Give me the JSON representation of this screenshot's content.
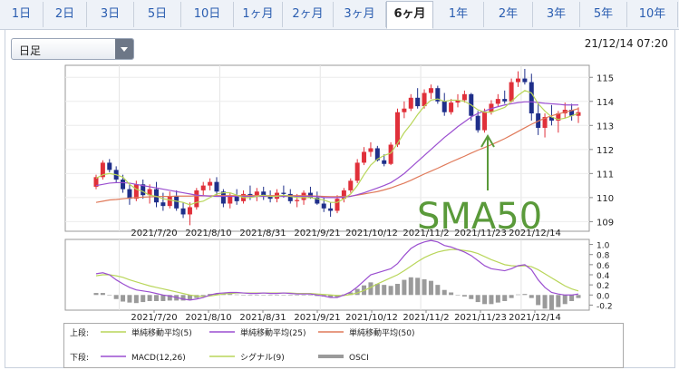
{
  "tabs": [
    {
      "label": "1日",
      "active": false
    },
    {
      "label": "2日",
      "active": false
    },
    {
      "label": "3日",
      "active": false
    },
    {
      "label": "5日",
      "active": false
    },
    {
      "label": "10日",
      "active": false
    },
    {
      "label": "1ヶ月",
      "active": false
    },
    {
      "label": "2ヶ月",
      "active": false
    },
    {
      "label": "3ヶ月",
      "active": false
    },
    {
      "label": "6ヶ月",
      "active": true
    },
    {
      "label": "1年",
      "active": false
    },
    {
      "label": "2年",
      "active": false
    },
    {
      "label": "3年",
      "active": false
    },
    {
      "label": "5年",
      "active": false
    },
    {
      "label": "10年",
      "active": false
    }
  ],
  "selector": {
    "value": "日足"
  },
  "timestamp": "21/12/14 07:20",
  "colors": {
    "up": "#e0303a",
    "down": "#1f2f8a",
    "sma5": "#b9d65a",
    "sma25": "#9b4fd0",
    "sma50": "#e07a5a",
    "macd": "#9b4fd0",
    "signal": "#b9d65a",
    "osci": "#9a9a9a",
    "annotation": "#5a9a3a"
  },
  "annotation": {
    "text": "SMA50"
  },
  "legend": {
    "upper_label": "上段:",
    "lower_label": "下段:",
    "items_upper": [
      {
        "label": "単純移動平均(5)"
      },
      {
        "label": "単純移動平均(25)"
      },
      {
        "label": "単純移動平均(50)"
      }
    ],
    "items_lower": [
      {
        "label": "MACD(12,26)"
      },
      {
        "label": "シグナル(9)"
      },
      {
        "label": "OSCI"
      }
    ]
  },
  "chart_data": [
    {
      "type": "candlestick",
      "x_tick_labels": [
        "2021/7/20",
        "2021/8/10",
        "2021/8/31",
        "2021/9/21",
        "2021/10/12",
        "2021/11/2",
        "2021/11/23",
        "2021/12/14"
      ],
      "yticks": [
        109,
        110,
        111,
        112,
        113,
        114,
        115
      ],
      "ylim": [
        108.6,
        115.5
      ],
      "candles": [
        [
          110.45,
          110.95,
          110.35,
          110.85
        ],
        [
          110.85,
          111.55,
          110.75,
          111.45
        ],
        [
          111.45,
          111.6,
          111.05,
          111.15
        ],
        [
          111.15,
          111.3,
          110.6,
          110.75
        ],
        [
          110.75,
          110.95,
          110.2,
          110.35
        ],
        [
          110.35,
          110.55,
          109.7,
          109.95
        ],
        [
          109.95,
          110.7,
          109.85,
          110.55
        ],
        [
          110.55,
          110.75,
          109.95,
          110.1
        ],
        [
          110.1,
          110.55,
          109.75,
          110.35
        ],
        [
          110.35,
          110.65,
          109.6,
          109.8
        ],
        [
          109.8,
          110.2,
          109.45,
          109.65
        ],
        [
          109.65,
          110.25,
          109.55,
          110.05
        ],
        [
          110.05,
          110.3,
          109.45,
          109.55
        ],
        [
          109.55,
          109.8,
          109.15,
          109.3
        ],
        [
          109.3,
          109.8,
          108.85,
          109.6
        ],
        [
          109.6,
          110.4,
          109.5,
          110.3
        ],
        [
          110.3,
          110.65,
          110.1,
          110.5
        ],
        [
          110.5,
          110.8,
          110.3,
          110.65
        ],
        [
          110.65,
          110.85,
          110.1,
          110.25
        ],
        [
          110.25,
          110.35,
          109.6,
          109.75
        ],
        [
          109.75,
          110.2,
          109.55,
          110.05
        ],
        [
          110.05,
          110.35,
          109.7,
          109.85
        ],
        [
          109.85,
          110.3,
          109.75,
          110.15
        ],
        [
          110.15,
          110.5,
          109.9,
          110.1
        ],
        [
          110.1,
          110.4,
          109.85,
          110.25
        ],
        [
          110.25,
          110.45,
          109.9,
          110.05
        ],
        [
          110.05,
          110.3,
          109.8,
          109.95
        ],
        [
          109.95,
          110.35,
          109.8,
          110.2
        ],
        [
          110.2,
          110.5,
          110.0,
          110.15
        ],
        [
          110.15,
          110.35,
          109.75,
          109.85
        ],
        [
          109.85,
          110.15,
          109.6,
          109.9
        ],
        [
          109.9,
          110.3,
          109.7,
          110.2
        ],
        [
          110.2,
          110.45,
          109.95,
          110.0
        ],
        [
          110.0,
          110.25,
          109.7,
          109.75
        ],
        [
          109.75,
          110.0,
          109.4,
          109.55
        ],
        [
          109.55,
          109.8,
          109.2,
          109.45
        ],
        [
          109.45,
          110.1,
          109.35,
          109.95
        ],
        [
          109.95,
          110.4,
          109.8,
          110.3
        ],
        [
          110.3,
          110.8,
          110.2,
          110.7
        ],
        [
          110.7,
          111.6,
          110.6,
          111.45
        ],
        [
          111.45,
          112.1,
          111.35,
          111.9
        ],
        [
          111.9,
          112.3,
          111.7,
          112.05
        ],
        [
          112.05,
          112.15,
          111.5,
          111.55
        ],
        [
          111.55,
          111.8,
          111.3,
          111.4
        ],
        [
          111.4,
          112.3,
          111.35,
          112.2
        ],
        [
          112.2,
          113.7,
          112.1,
          113.55
        ],
        [
          113.55,
          114.0,
          113.3,
          113.7
        ],
        [
          113.7,
          114.3,
          113.6,
          114.15
        ],
        [
          114.15,
          114.55,
          113.7,
          113.8
        ],
        [
          113.8,
          114.5,
          113.7,
          114.35
        ],
        [
          114.35,
          114.7,
          114.1,
          114.55
        ],
        [
          114.55,
          114.65,
          113.9,
          114.0
        ],
        [
          114.0,
          114.35,
          113.4,
          113.55
        ],
        [
          113.55,
          114.1,
          113.45,
          113.95
        ],
        [
          113.95,
          114.3,
          113.75,
          114.05
        ],
        [
          114.05,
          114.45,
          113.95,
          114.3
        ],
        [
          114.3,
          114.35,
          113.2,
          113.4
        ],
        [
          113.4,
          113.6,
          112.7,
          112.8
        ],
        [
          112.8,
          113.7,
          112.7,
          113.55
        ],
        [
          113.55,
          114.05,
          113.45,
          113.9
        ],
        [
          113.9,
          114.3,
          113.8,
          114.1
        ],
        [
          114.1,
          114.45,
          113.9,
          114.0
        ],
        [
          114.0,
          114.95,
          113.95,
          114.8
        ],
        [
          114.8,
          115.25,
          114.6,
          114.95
        ],
        [
          114.95,
          115.35,
          114.7,
          114.8
        ],
        [
          114.8,
          115.15,
          113.2,
          113.5
        ],
        [
          113.5,
          113.95,
          112.6,
          112.9
        ],
        [
          112.9,
          113.5,
          112.5,
          113.35
        ],
        [
          113.35,
          113.85,
          113.0,
          113.2
        ],
        [
          113.2,
          113.6,
          112.7,
          113.5
        ],
        [
          113.5,
          113.95,
          113.3,
          113.65
        ],
        [
          113.65,
          113.9,
          113.2,
          113.4
        ],
        [
          113.4,
          113.75,
          113.1,
          113.55
        ]
      ],
      "sma5": [
        110.8,
        110.95,
        111.0,
        110.95,
        110.85,
        110.55,
        110.35,
        110.25,
        110.1,
        110.05,
        109.95,
        109.9,
        109.85,
        109.8,
        109.7,
        109.8,
        109.85,
        110.0,
        110.15,
        110.2,
        110.2,
        110.1,
        110.0,
        110.0,
        110.05,
        110.1,
        110.05,
        110.05,
        110.1,
        110.05,
        110.0,
        110.0,
        110.0,
        109.95,
        109.9,
        109.8,
        109.8,
        109.95,
        110.15,
        110.5,
        110.95,
        111.35,
        111.6,
        111.75,
        111.85,
        112.25,
        112.7,
        113.05,
        113.45,
        113.8,
        114.05,
        114.1,
        114.0,
        114.05,
        114.05,
        114.0,
        113.85,
        113.65,
        113.55,
        113.55,
        113.65,
        113.75,
        114.0,
        114.25,
        114.45,
        114.35,
        113.9,
        113.6,
        113.35,
        113.25,
        113.3,
        113.4,
        113.5
      ],
      "sma25": [
        110.5,
        110.55,
        110.6,
        110.62,
        110.62,
        110.6,
        110.55,
        110.5,
        110.45,
        110.4,
        110.35,
        110.3,
        110.25,
        110.2,
        110.15,
        110.1,
        110.08,
        110.06,
        110.05,
        110.05,
        110.05,
        110.05,
        110.05,
        110.05,
        110.05,
        110.05,
        110.05,
        110.05,
        110.05,
        110.05,
        110.05,
        110.05,
        110.05,
        110.05,
        110.0,
        110.0,
        110.0,
        110.02,
        110.05,
        110.12,
        110.2,
        110.3,
        110.4,
        110.5,
        110.62,
        110.8,
        111.0,
        111.25,
        111.5,
        111.75,
        112.0,
        112.25,
        112.5,
        112.72,
        112.95,
        113.15,
        113.35,
        113.5,
        113.6,
        113.7,
        113.78,
        113.85,
        113.9,
        113.95,
        113.98,
        113.98,
        113.95,
        113.92,
        113.9,
        113.88,
        113.85,
        113.85,
        113.85
      ],
      "sma50": [
        109.8,
        109.85,
        109.9,
        109.92,
        109.95,
        109.98,
        110.0,
        110.02,
        110.03,
        110.04,
        110.05,
        110.05,
        110.06,
        110.06,
        110.06,
        110.07,
        110.07,
        110.07,
        110.08,
        110.08,
        110.08,
        110.08,
        110.08,
        110.08,
        110.08,
        110.08,
        110.08,
        110.08,
        110.08,
        110.08,
        110.08,
        110.08,
        110.07,
        110.06,
        110.05,
        110.04,
        110.04,
        110.05,
        110.06,
        110.1,
        110.15,
        110.2,
        110.25,
        110.32,
        110.4,
        110.5,
        110.6,
        110.72,
        110.85,
        110.98,
        111.1,
        111.22,
        111.35,
        111.48,
        111.6,
        111.72,
        111.85,
        111.97,
        112.08,
        112.2,
        112.32,
        112.45,
        112.6,
        112.75,
        112.9,
        113.05,
        113.18,
        113.3,
        113.4,
        113.48,
        113.55,
        113.62,
        113.7
      ]
    },
    {
      "type": "line",
      "yticks": [
        1.0,
        0.8,
        0.6,
        0.4,
        0.2,
        0.0,
        -0.2
      ],
      "ylim": [
        -0.3,
        1.1
      ],
      "macd": [
        0.42,
        0.44,
        0.4,
        0.3,
        0.22,
        0.15,
        0.1,
        0.08,
        0.06,
        0.03,
        0.0,
        -0.02,
        -0.05,
        -0.08,
        -0.1,
        -0.08,
        -0.05,
        0.0,
        0.03,
        0.04,
        0.05,
        0.05,
        0.04,
        0.03,
        0.03,
        0.04,
        0.03,
        0.03,
        0.04,
        0.03,
        0.02,
        0.02,
        0.02,
        0.0,
        -0.02,
        -0.05,
        -0.05,
        0.0,
        0.06,
        0.16,
        0.28,
        0.4,
        0.44,
        0.48,
        0.52,
        0.62,
        0.78,
        0.92,
        1.0,
        1.05,
        1.08,
        1.05,
        0.98,
        0.95,
        0.9,
        0.85,
        0.78,
        0.68,
        0.58,
        0.52,
        0.5,
        0.48,
        0.52,
        0.58,
        0.6,
        0.5,
        0.3,
        0.15,
        0.05,
        0.02,
        0.0,
        0.0,
        0.02
      ],
      "signal": [
        0.38,
        0.4,
        0.4,
        0.38,
        0.35,
        0.3,
        0.26,
        0.22,
        0.18,
        0.15,
        0.12,
        0.09,
        0.06,
        0.03,
        0.0,
        -0.02,
        -0.03,
        -0.02,
        0.0,
        0.02,
        0.03,
        0.04,
        0.04,
        0.04,
        0.04,
        0.04,
        0.04,
        0.04,
        0.04,
        0.04,
        0.03,
        0.03,
        0.03,
        0.02,
        0.01,
        0.0,
        -0.01,
        -0.01,
        0.01,
        0.04,
        0.09,
        0.15,
        0.22,
        0.28,
        0.34,
        0.4,
        0.48,
        0.57,
        0.66,
        0.74,
        0.8,
        0.85,
        0.88,
        0.9,
        0.9,
        0.88,
        0.86,
        0.82,
        0.76,
        0.7,
        0.65,
        0.6,
        0.58,
        0.57,
        0.58,
        0.56,
        0.5,
        0.42,
        0.34,
        0.26,
        0.18,
        0.12,
        0.08
      ]
    }
  ]
}
